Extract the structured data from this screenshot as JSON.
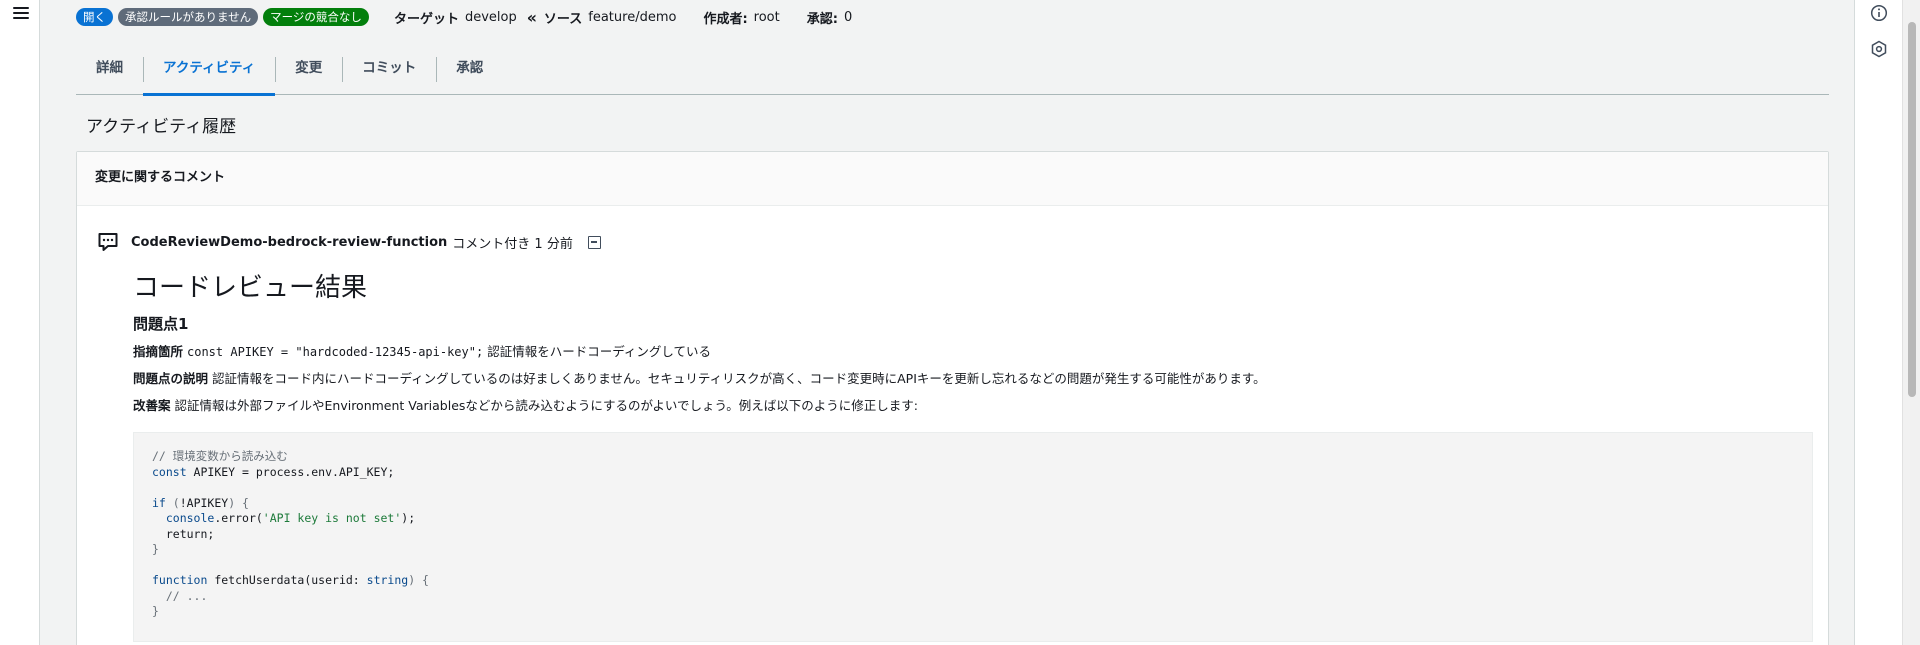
{
  "status": {
    "badges": [
      "開く",
      "承認ルールがありません",
      "マージの競合なし"
    ],
    "target_label": "ターゲット",
    "target_value": "develop",
    "source_label": "ソース",
    "source_value": "feature/demo",
    "author_label": "作成者:",
    "author_value": "root",
    "approval_label": "承認:",
    "approval_value": "0"
  },
  "tabs": [
    "詳細",
    "アクティビティ",
    "変更",
    "コミット",
    "承認"
  ],
  "active_tab": "アクティビティ",
  "history_title": "アクティビティ履歴",
  "panel": {
    "header": "変更に関するコメント",
    "comment": {
      "author": "CodeReviewDemo-bedrock-review-function",
      "meta": "コメント付き 1 分前"
    }
  },
  "review": {
    "title": "コードレビュー結果",
    "issue_heading": "問題点1",
    "location_label": "指摘箇所",
    "location_code": "const APIKEY = \"hardcoded-12345-api-key\";",
    "location_text": "認証情報をハードコーディングしている",
    "explanation_label": "問題点の説明",
    "explanation_text": "認証情報をコード内にハードコーディングしているのは好ましくありません。セキュリティリスクが高く、コード変更時にAPIキーを更新し忘れるなどの問題が発生する可能性があります。",
    "suggestion_label": "改善案",
    "suggestion_text": "認証情報は外部ファイルやEnvironment Variablesなどから読み込むようにするのがよいでしょう。例えば以下のように修正します:"
  },
  "code": {
    "l1": "// 環境変数から読み込む",
    "l2_kw": "const",
    "l2_rest": " APIKEY = process.env.API_KEY;",
    "l4_kw": "if",
    "l4_open": " (",
    "l4_mid": "!APIKEY",
    "l4_close": ") {",
    "l5_obj": "console",
    "l5_call": ".error(",
    "l5_str": "'API key is not set'",
    "l5_end": ");",
    "l6": "return;",
    "l7": "}",
    "l9_kw": "function",
    "l9_name": " fetchUserdata(",
    "l9_param": "userid: ",
    "l9_type": "string",
    "l9_end": ") {",
    "l10": "// ...",
    "l11": "}"
  },
  "icons": {
    "menu": "hamburger-menu-icon",
    "info": "info-icon",
    "settings": "hexagon-settings-icon",
    "comment": "comment-bubble-icon",
    "collapse": "collapse-minus-icon"
  },
  "colors": {
    "accent": "#0972d3",
    "badge_open": "#0972d3",
    "badge_norule": "#5f6b7a",
    "badge_nomerge": "#037f0c"
  }
}
